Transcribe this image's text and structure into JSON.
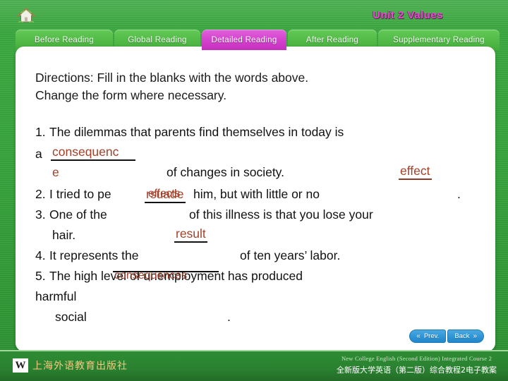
{
  "header": {
    "home_icon": "home-icon",
    "unit_title": "Unit 2  Values"
  },
  "tabs": [
    {
      "label": "Before Reading",
      "active": false
    },
    {
      "label": "Global Reading",
      "active": false
    },
    {
      "label": "Detailed Reading",
      "active": true
    },
    {
      "label": "After Reading",
      "active": false
    },
    {
      "label": "Supplementary Reading",
      "active": false
    }
  ],
  "content": {
    "directions_line1": "Directions: Fill in the blanks with the words above.",
    "directions_line2": "Change the form where necessary.",
    "items": {
      "n1": "1.",
      "n1_text_a": "The dilemmas that parents find themselves in today is",
      "n1_text_b": "a",
      "n1_answer_part1": "consequenc",
      "n1_answer_part2": "e",
      "n1_text_c": "of changes in society.",
      "n1_side_answer": "effect",
      "n2": "2.",
      "n2_text_a": "I tried to pe",
      "n2_blank": "rsuade",
      "n2_overlay": "effects",
      "n2_text_b": "him, but with little or no",
      "n2_period": ".",
      "n3": "3.",
      "n3_text_a": "One of the",
      "n3_text_b": "of this illness is that you lose your",
      "n3_text_c": "hair.",
      "n3_answer": "result",
      "n4": "4.",
      "n4_text_a": "It represents the",
      "n4_text_b": "of ten years’ labor.",
      "n5": "5.",
      "n5_text_a": "The high level of unemployment has produced",
      "n5_overlay": "consequences",
      "n5_text_b": "harmful",
      "n5_text_c": "social",
      "n5_period": "."
    }
  },
  "nav": {
    "prev_label": "Prev.",
    "prev_icon": "chevron-double-left-icon",
    "next_label": "Back",
    "next_icon": "chevron-double-right-icon"
  },
  "footer": {
    "logo_mark": "W",
    "press_name": "上海外语教育出版社",
    "course_en": "New College English (Second Edition) Integrated Course 2",
    "course_cn": "全新版大学英语（第二版）综合教程2电子教案"
  },
  "colors": {
    "bg_green": "#37a43c",
    "tab_green": "#55bd4a",
    "tab_active_magenta": "#d646cf",
    "title_magenta": "#e93fd0",
    "answer_brown": "#a2412a",
    "nav_blue": "#2f95d6"
  }
}
